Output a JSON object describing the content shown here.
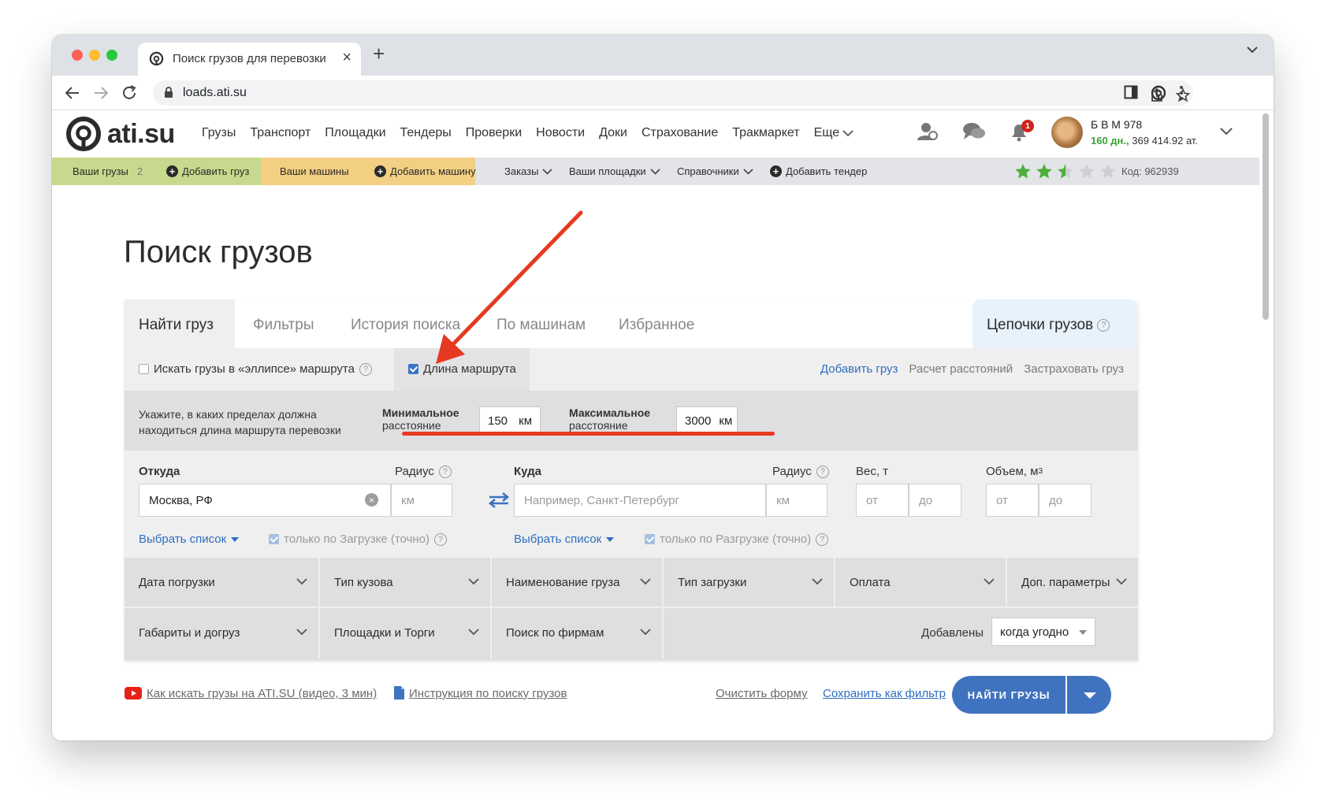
{
  "browser": {
    "tab_title": "Поиск грузов для перевозки",
    "url": "loads.ati.su"
  },
  "site": {
    "logo_text": "ati.su",
    "menu": [
      "Грузы",
      "Транспорт",
      "Площадки",
      "Тендеры",
      "Проверки",
      "Новости",
      "Доки",
      "Страхование",
      "Тракмаркет"
    ],
    "menu_more": "Еще",
    "notification_count": "1",
    "user": {
      "name": "Б В М 978",
      "days": "160 дн.,",
      "points": "369 414.92 ат."
    }
  },
  "subnav": {
    "your_loads": "Ваши грузы",
    "your_loads_count": "2",
    "add_load": "Добавить груз",
    "your_trucks": "Ваши машины",
    "add_truck": "Добавить машину",
    "orders": "Заказы",
    "your_platforms": "Ваши площадки",
    "references": "Справочники",
    "add_tender": "Добавить тендер",
    "rating": 2.5,
    "code": "Код: 962939"
  },
  "page": {
    "title": "Поиск грузов"
  },
  "form": {
    "tabs": [
      "Найти груз",
      "Фильтры",
      "История поиска",
      "По машинам",
      "Избранное"
    ],
    "active_tab": "Найти груз",
    "chains_tab": "Цепочки грузов",
    "ellipse_option": "Искать грузы в «эллипсе» маршрута",
    "route_length_option": "Длина маршрута",
    "links": {
      "add_load": "Добавить груз",
      "distance_calc": "Расчет расстояний",
      "insure": "Застраховать груз"
    },
    "distance": {
      "hint": "Укажите, в каких пределах должна находиться длина маршрута перевозки",
      "min_label_bold": "Минимальное",
      "min_label": "расстояние",
      "min_value": "150",
      "max_label_bold": "Максимальное",
      "max_label": "расстояние",
      "max_value": "3000",
      "unit": "км"
    },
    "route": {
      "from_label": "Откуда",
      "from_value": "Москва, РФ",
      "radius_label": "Радиус",
      "radius_placeholder": "км",
      "to_label": "Куда",
      "to_placeholder": "Например, Санкт-Петербург",
      "weight_label": "Вес, т",
      "volume_label": "Объем, м",
      "volume_sup": "3",
      "from_placeholder": "от",
      "to_short_placeholder": "до",
      "select_list": "Выбрать список",
      "only_loading": "только по Загрузке (точно)",
      "only_unloading": "только по Разгрузке (точно)"
    },
    "filters": [
      "Дата погрузки",
      "Тип кузова",
      "Наименование груза",
      "Тип загрузки",
      "Оплата",
      "Доп. параметры",
      "Габариты и догруз",
      "Площадки и Торги",
      "Поиск по фирмам"
    ],
    "added_label": "Добавлены",
    "added_value": "когда угодно"
  },
  "bottom": {
    "video_link": "Как искать грузы на ATI.SU (видео, 3 мин)",
    "guide_link": "Инструкция по поиску грузов",
    "clear_form": "Очистить форму",
    "save_filter": "Сохранить как фильтр",
    "find_button": "НАЙТИ ГРУЗЫ"
  },
  "colors": {
    "accent_blue": "#3f73bf",
    "annotation_red": "#e53a21",
    "green_band": "#c7d98c",
    "yellow_band": "#f2cf83"
  }
}
